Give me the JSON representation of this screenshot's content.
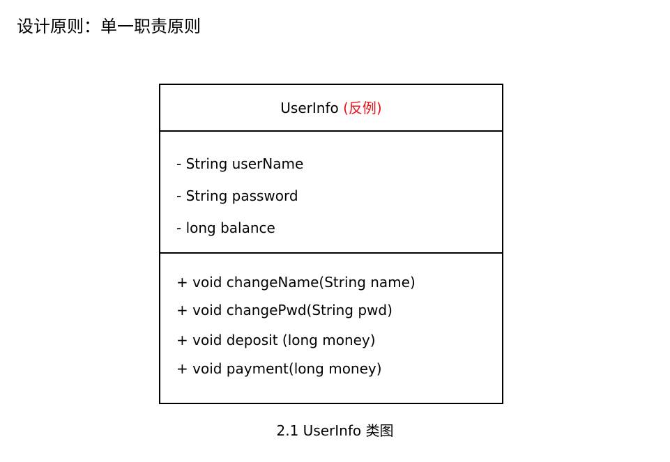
{
  "page": {
    "title": "设计原则：单一职责原则"
  },
  "uml_class": {
    "name": "UserInfo",
    "name_tag": "(反例)",
    "attributes": [
      "- String userName",
      "- String password",
      "- long balance"
    ],
    "methods": [
      "+ void changeName(String name)",
      "+ void changePwd(String pwd)",
      "+ void deposit (long money)",
      "+ void payment(long money)"
    ]
  },
  "caption": "2.1 UserInfo  类图",
  "colors": {
    "text": "#000000",
    "tag": "#e8141a",
    "border": "#000000",
    "background": "#ffffff"
  }
}
